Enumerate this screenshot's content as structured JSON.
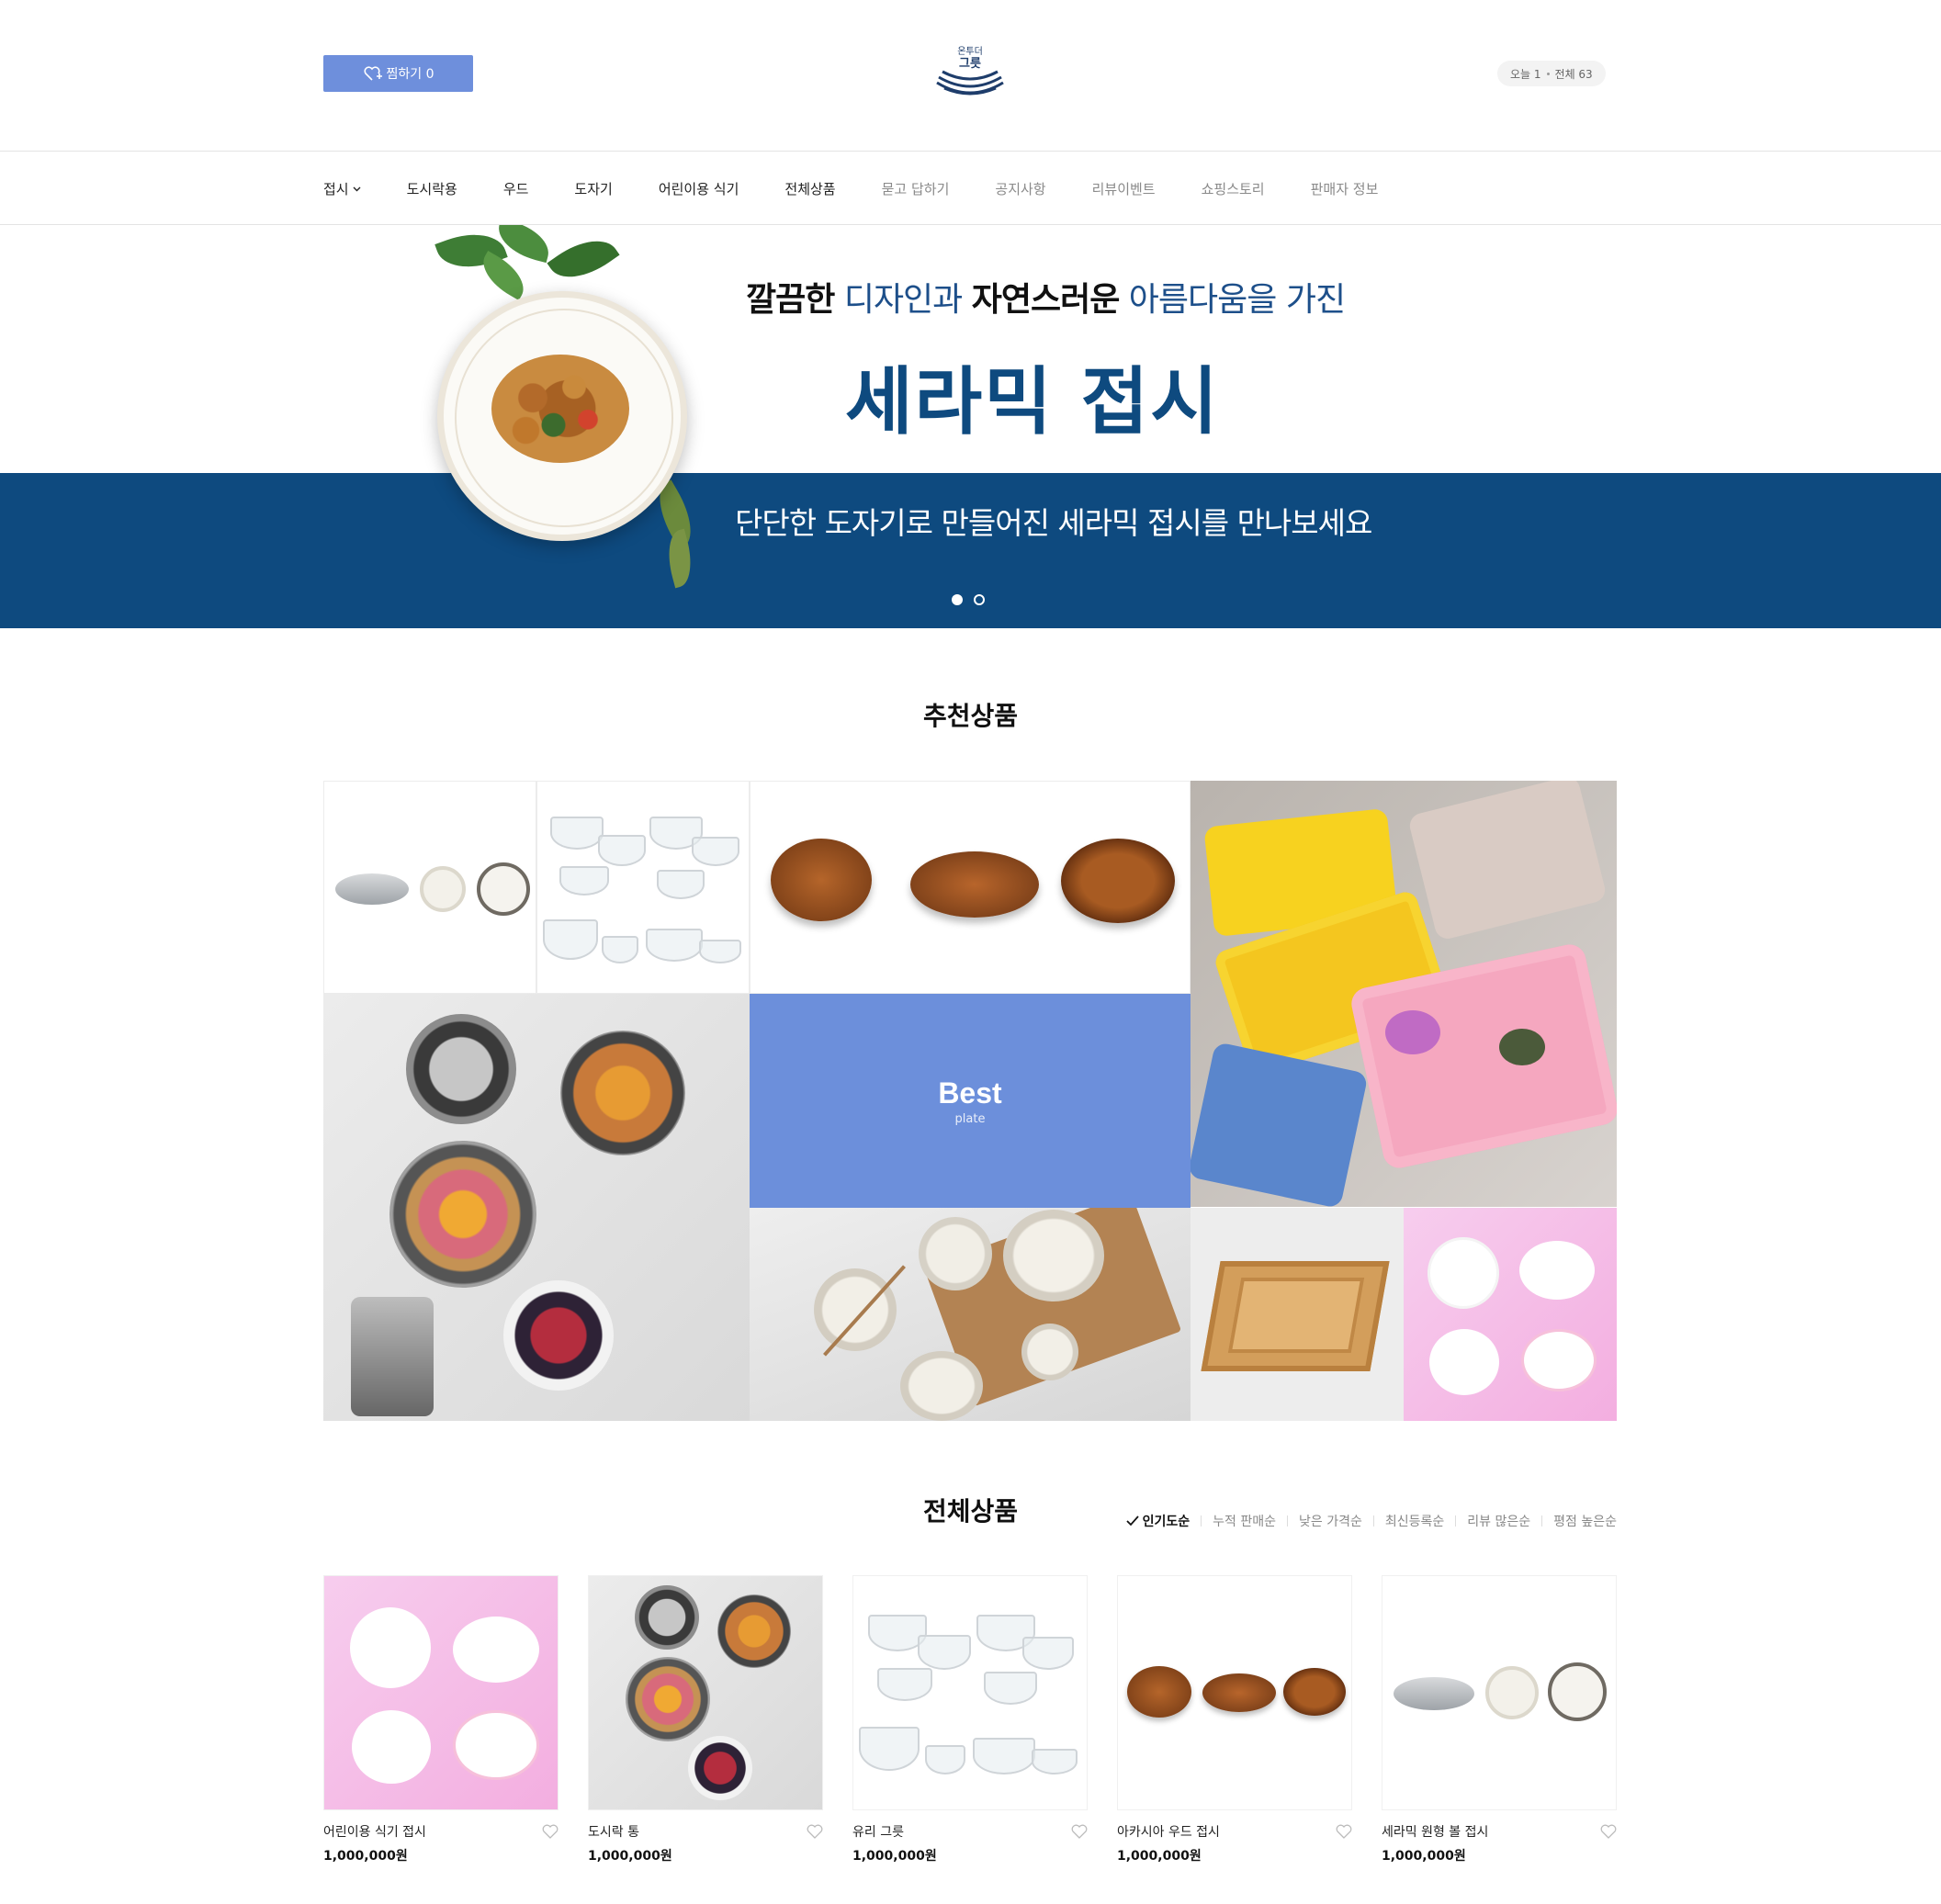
{
  "header": {
    "wish_label": "찜하기 0",
    "logo_small": "온투더",
    "logo_big": "그릇",
    "visit_today": "오늘 1",
    "visit_total": "전체 63"
  },
  "nav": {
    "items": [
      "접시",
      "도시락용",
      "우드",
      "도자기",
      "어린이용 식기",
      "전체상품"
    ],
    "board_items": [
      "묻고 답하기",
      "공지사항",
      "리뷰이벤트",
      "쇼핑스토리",
      "판매자 정보"
    ]
  },
  "hero": {
    "line1_a": "깔끔한",
    "line1_b": " 디자인과 ",
    "line1_c": "자연스러운",
    "line1_d": " 아름다움을 가진",
    "title": "세라믹 접시",
    "subtitle": "단단한 도자기로 만들어진 세라믹 접시를 만나보세요",
    "band_color": "#0e4a7f",
    "slides": 2,
    "active_slide": 1
  },
  "recommended": {
    "title": "추천상품",
    "best_label": "Best",
    "best_sub": "plate",
    "best_color": "#6c8fdb"
  },
  "all_products": {
    "title": "전체상품",
    "sort_options": [
      "인기도순",
      "누적 판매순",
      "낮은 가격순",
      "최신등록순",
      "리뷰 많은순",
      "평점 높은순"
    ],
    "active_sort": "인기도순",
    "items": [
      {
        "name": "어린이용 식기 접시",
        "price": "1,000,000원"
      },
      {
        "name": "도시락 통",
        "price": "1,000,000원"
      },
      {
        "name": "유리 그릇",
        "price": "1,000,000원"
      },
      {
        "name": "아카시아 우드 접시",
        "price": "1,000,000원"
      },
      {
        "name": "세라믹 원형 볼 접시",
        "price": "1,000,000원"
      }
    ]
  },
  "icons": {
    "wish": "heart-plus-icon",
    "nav_dropdown": "chevron-down-icon",
    "sort_check": "check-icon",
    "product_like": "heart-icon"
  }
}
